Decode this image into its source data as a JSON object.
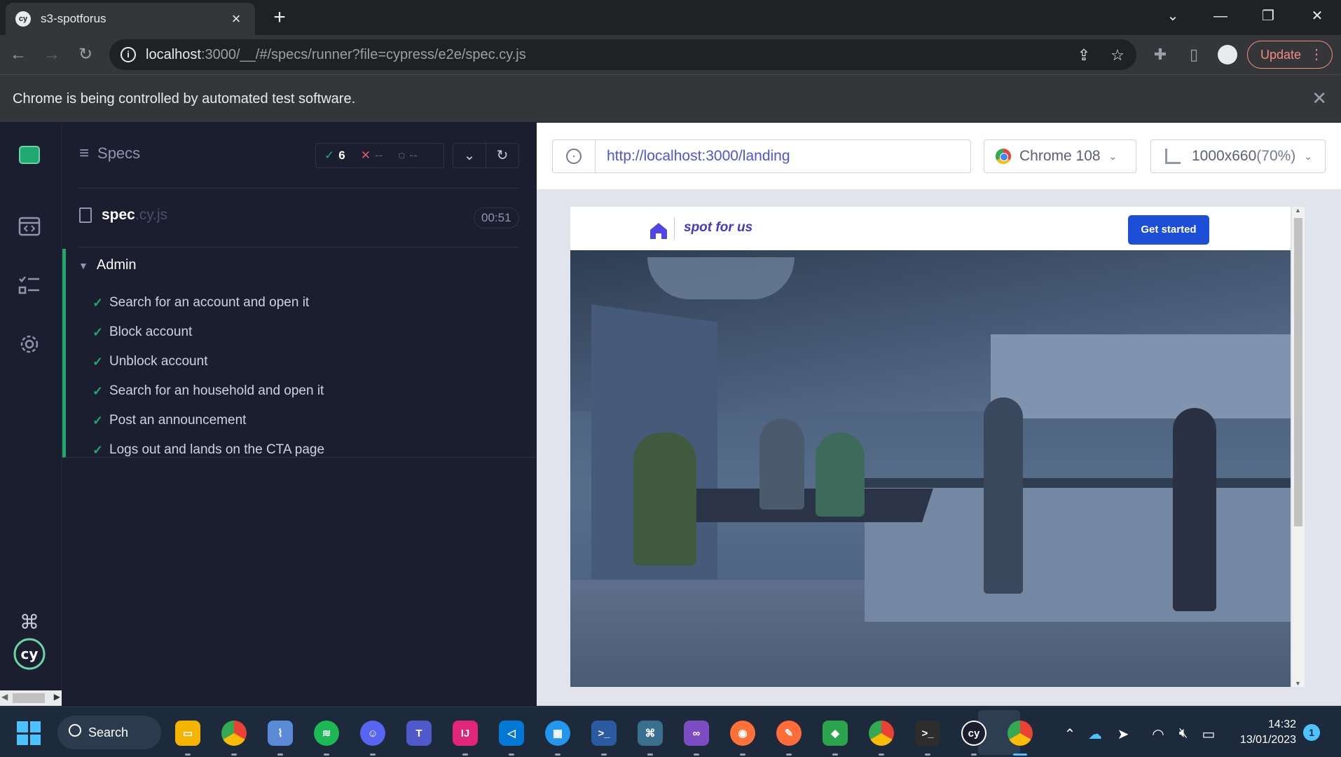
{
  "browser": {
    "tab_title": "s3-spotforus",
    "favicon_text": "cy",
    "url_host": "localhost",
    "url_rest": ":3000/__/#/specs/runner?file=cypress/e2e/spec.cy.js",
    "update_label": "Update",
    "infobar_text": "Chrome is being controlled by automated test software."
  },
  "reporter": {
    "title": "Specs",
    "passed_count": "6",
    "failed_count": "--",
    "pending_count": "--",
    "spec_name": "spec",
    "spec_ext": ".cy.js",
    "duration": "00:51",
    "suite_title": "Admin",
    "tests": [
      "Search for an account and open it",
      "Block account",
      "Unblock account",
      "Search for an household and open it",
      "Post an announcement",
      "Logs out and lands on the CTA page"
    ]
  },
  "aut": {
    "url": "http://localhost:3000/landing",
    "browser_label": "Chrome 108",
    "viewport_label": "1000x660",
    "viewport_scale": "(70%)"
  },
  "app": {
    "brand": "spot for us",
    "cta_label": "Get started"
  },
  "taskbar": {
    "search_label": "Search",
    "time": "14:32",
    "date": "13/01/2023",
    "notifications": "1"
  },
  "colors": {
    "cypress_green": "#1fa971",
    "cypress_red": "#e45770",
    "cta_blue": "#1d4ed8",
    "brand_indigo": "#4338ca"
  }
}
